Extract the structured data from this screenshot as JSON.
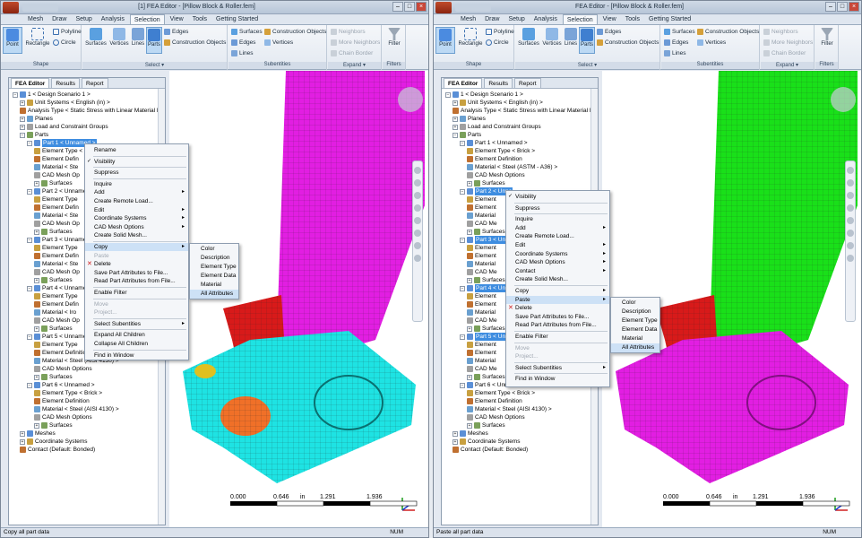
{
  "left": {
    "title": "[1] FEA Editor - [Pillow Block & Roller.fem]",
    "tabs": [
      "Mesh",
      "Draw",
      "Setup",
      "Analysis",
      "Selection",
      "View",
      "Tools",
      "Getting Started"
    ],
    "active_tab": "Selection",
    "ribbon": {
      "shape": {
        "label": "Shape",
        "point": "Point",
        "rectangle": "Rectangle",
        "polyline": "Polyline",
        "circle": "Circle"
      },
      "select": {
        "label": "Select",
        "surfaces": "Surfaces",
        "vertices": "Vertices",
        "lines": "Lines",
        "parts": "Parts",
        "edges": "Edges",
        "construction_objects": "Construction Objects"
      },
      "subentities": {
        "label": "Subentities",
        "surfaces": "Surfaces",
        "edges": "Edges",
        "lines": "Lines",
        "construction_objects": "Construction Objects",
        "vertices": "Vertices"
      },
      "expand": {
        "label": "Expand",
        "neighbors": "Neighbors",
        "more_neighbors": "More Neighbors",
        "chain_border": "Chain Border"
      },
      "filters": {
        "label": "Filters",
        "filter": "Filter"
      }
    },
    "panel_tabs": [
      "FEA Editor",
      "Results",
      "Report"
    ],
    "tree": [
      "1 < Design Scenario 1 >",
      "Unit Systems < English (in) >",
      "Analysis Type < Static Stress with Linear Material Mod",
      "Planes",
      "Load and Constraint Groups",
      "Parts",
      "Part 1 < Unnamed >",
      "Element Type < Br",
      "Element Defin",
      "Material < Ste",
      "CAD Mesh Op",
      "Surfaces",
      "Part 2 < Unnamed",
      "Element Type",
      "Element Defin",
      "Material < Ste",
      "CAD Mesh Op",
      "Surfaces",
      "Part 3 < Unnamed",
      "Element Type",
      "Element Defin",
      "Material < Ste",
      "CAD Mesh Op",
      "Surfaces",
      "Part 4 < Unnamed",
      "Element Type",
      "Element Defin",
      "Material < Iro",
      "CAD Mesh Op",
      "Surfaces",
      "Part 5 < Unnamed",
      "Element Type",
      "Element Definition",
      "Material < Steel (AISI 4130) >",
      "CAD Mesh Options",
      "Surfaces",
      "Part 6 < Unnamed >",
      "Element Type < Brick >",
      "Element Definition",
      "Material < Steel (AISI 4130) >",
      "CAD Mesh Options",
      "Surfaces",
      "Meshes",
      "Coordinate Systems",
      "Contact (Default: Bonded)"
    ],
    "context_menu": [
      "Rename",
      "Visibility",
      "Suppress",
      "Inquire",
      "Add",
      "Create Remote Load...",
      "Edit",
      "Coordinate Systems",
      "CAD Mesh Options",
      "Create Solid Mesh...",
      "Copy",
      "Paste",
      "Delete",
      "Save Part Attributes to File...",
      "Read Part Attributes from File...",
      "Enable Filter",
      "Move",
      "Project...",
      "Select Subentities",
      "Expand All Children",
      "Collapse All Children",
      "Find in Window"
    ],
    "submenu": [
      "Color",
      "Description",
      "Element Type",
      "Element Data",
      "Material",
      "All Attributes"
    ],
    "scale": [
      "0.000",
      "0.646",
      "in",
      "1.291",
      "1.936"
    ],
    "status": "Copy all part data",
    "num": "NUM",
    "colors": {
      "cylinder": "#e21ee2",
      "block": "#1ee3e3",
      "cone": "#d81a1a"
    }
  },
  "right": {
    "title": "FEA Editor - [Pillow Block & Roller.fem]",
    "tabs": [
      "Mesh",
      "Draw",
      "Setup",
      "Analysis",
      "Selection",
      "View",
      "Tools",
      "Getting Started"
    ],
    "active_tab": "Selection",
    "ribbon": {
      "shape": {
        "label": "Shape",
        "point": "Point",
        "rectangle": "Rectangle",
        "polyline": "Polyline",
        "circle": "Circle"
      },
      "select": {
        "label": "Select",
        "surfaces": "Surfaces",
        "vertices": "Vertices",
        "lines": "Lines",
        "parts": "Parts",
        "edges": "Edges",
        "construction_objects": "Construction Objects"
      },
      "subentities": {
        "label": "Subentities",
        "surfaces": "Surfaces",
        "edges": "Edges",
        "lines": "Lines",
        "construction_objects": "Construction Objects",
        "vertices": "Vertices"
      },
      "expand": {
        "label": "Expand",
        "neighbors": "Neighbors",
        "more_neighbors": "More Neighbors",
        "chain_border": "Chain Border"
      },
      "filters": {
        "label": "Filters",
        "filter": "Filter"
      }
    },
    "panel_tabs": [
      "FEA Editor",
      "Results",
      "Report"
    ],
    "tree": [
      "1 < Design Scenario 1 >",
      "Unit Systems < English (in) >",
      "Analysis Type < Static Stress with Linear Material Mod",
      "Planes",
      "Load and Constraint Groups",
      "Parts",
      "Part 1 < Unnamed >",
      "Element Type < Brick >",
      "Element Definition",
      "Material < Steel (ASTM - A36) >",
      "CAD Mesh Options",
      "Surfaces",
      "Part 2 < Unna",
      "Element",
      "Element",
      "Material",
      "CAD Me",
      "Surfaces",
      "Part 3 < Unna",
      "Element",
      "Element",
      "Material",
      "CAD Me",
      "Surfaces",
      "Part 4 < Unna",
      "Element",
      "Element",
      "Material",
      "CAD Me",
      "Surfaces",
      "Part 5 < Unna",
      "Element",
      "Element",
      "Material",
      "CAD Me",
      "Surfaces",
      "Part 6 < Unnamed >",
      "Element Type < Brick >",
      "Element Definition",
      "Material < Steel (AISI 4130) >",
      "CAD Mesh Options",
      "Surfaces",
      "Meshes",
      "Coordinate Systems",
      "Contact (Default: Bonded)"
    ],
    "context_menu": [
      "Visibility",
      "Suppress",
      "Inquire",
      "Add",
      "Create Remote Load...",
      "Edit",
      "Coordinate Systems",
      "CAD Mesh Options",
      "Contact",
      "Create Solid Mesh...",
      "Copy",
      "Paste",
      "Delete",
      "Save Part Attributes to File...",
      "Read Part Attributes from File...",
      "Enable Filter",
      "Move",
      "Project...",
      "Select Subentities",
      "Find in Window"
    ],
    "submenu": [
      "Color",
      "Description",
      "Element Type",
      "Element Data",
      "Material",
      "All Attributes"
    ],
    "scale": [
      "0.000",
      "0.646",
      "in",
      "1.291",
      "1.936"
    ],
    "status": "Paste all part data",
    "num": "NUM",
    "colors": {
      "cylinder": "#19e019",
      "block": "#e21ee2",
      "cone": "#d81a1a"
    }
  }
}
